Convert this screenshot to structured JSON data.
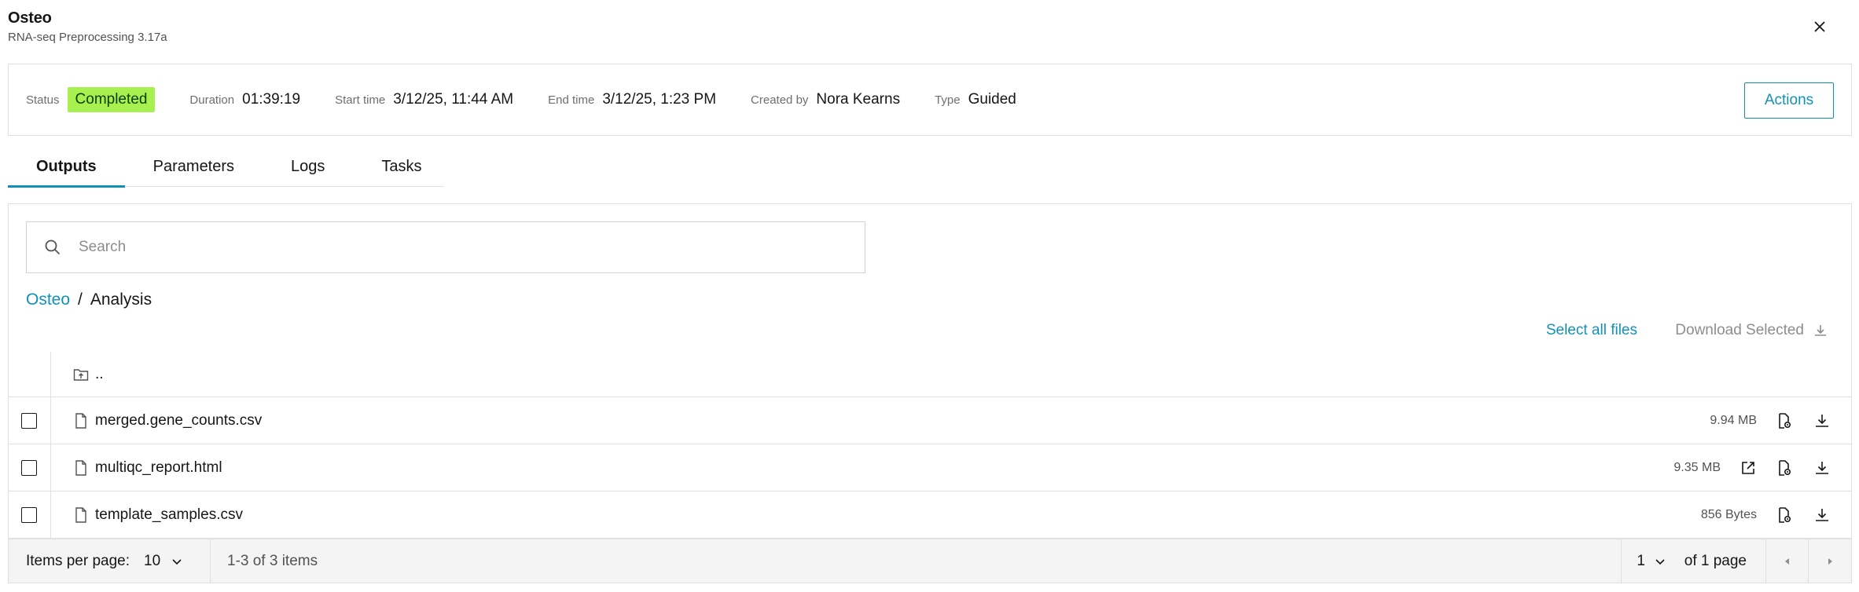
{
  "header": {
    "title": "Osteo",
    "subtitle": "RNA-seq Preprocessing 3.17a"
  },
  "status_bar": {
    "status_label": "Status",
    "status_value": "Completed",
    "duration_label": "Duration",
    "duration_value": "01:39:19",
    "start_label": "Start time",
    "start_value": "3/12/25, 11:44 AM",
    "end_label": "End time",
    "end_value": "3/12/25, 1:23 PM",
    "created_label": "Created by",
    "created_value": "Nora Kearns",
    "type_label": "Type",
    "type_value": "Guided",
    "actions_label": "Actions",
    "status_color": "#a7f04f"
  },
  "tabs": [
    {
      "label": "Outputs",
      "active": true
    },
    {
      "label": "Parameters",
      "active": false
    },
    {
      "label": "Logs",
      "active": false
    },
    {
      "label": "Tasks",
      "active": false
    }
  ],
  "search": {
    "placeholder": "Search",
    "value": ""
  },
  "breadcrumb": {
    "root": "Osteo",
    "separator": "/",
    "current": "Analysis"
  },
  "toolbar": {
    "select_all": "Select all files",
    "download_selected": "Download Selected"
  },
  "parent_row": {
    "label": ".."
  },
  "files": [
    {
      "name": "merged.gene_counts.csv",
      "size": "9.94 MB",
      "has_open": false
    },
    {
      "name": "multiqc_report.html",
      "size": "9.35 MB",
      "has_open": true
    },
    {
      "name": "template_samples.csv",
      "size": "856 Bytes",
      "has_open": false
    }
  ],
  "pagination": {
    "items_per_page_label": "Items per page:",
    "items_per_page_value": "10",
    "range_text": "1-3 of 3 items",
    "page_value": "1",
    "of_pages": "of 1 page"
  },
  "colors": {
    "accent": "#1192b5",
    "border": "#e0e0e0"
  }
}
